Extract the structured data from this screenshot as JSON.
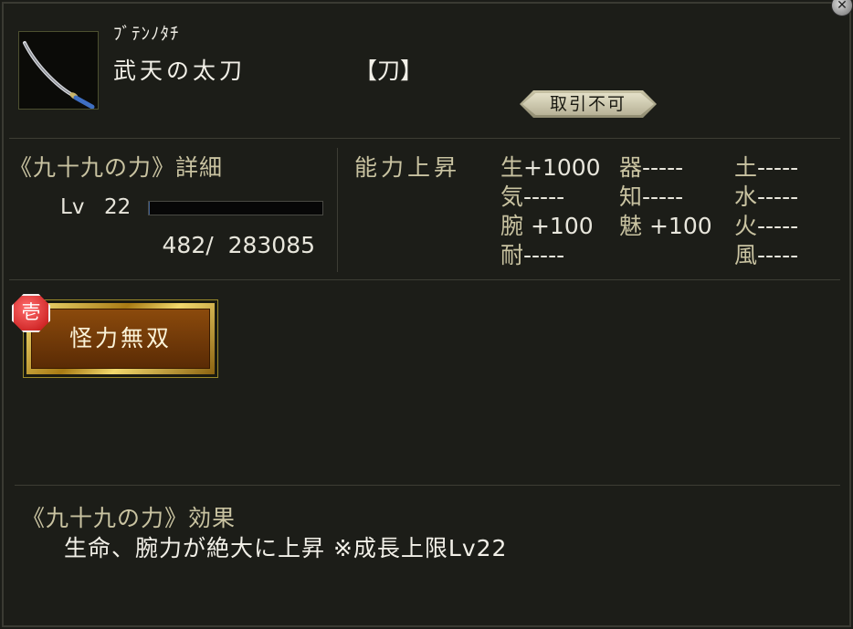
{
  "item": {
    "furigana": "ﾌﾞﾃﾝﾉﾀﾁ",
    "name": "武天の太刀",
    "type": "【刀】",
    "trade_status": "取引不可",
    "icon": "katana-icon"
  },
  "power_detail": {
    "title": "《九十九の力》詳細",
    "level_label": "Lv",
    "level_value": "22",
    "exp_text": "482/  283085",
    "exp_progress": 0.0017
  },
  "ability": {
    "title": "能力上昇",
    "stats": [
      {
        "label": "生",
        "value": "+1000"
      },
      {
        "label": "器",
        "value": "-----"
      },
      {
        "label": "土",
        "value": "-----"
      },
      {
        "label": "気",
        "value": "-----"
      },
      {
        "label": "知",
        "value": "-----"
      },
      {
        "label": "水",
        "value": "-----"
      },
      {
        "label": "腕",
        "value": " +100"
      },
      {
        "label": "魅",
        "value": " +100"
      },
      {
        "label": "火",
        "value": "-----"
      },
      {
        "label": "耐",
        "value": "-----"
      },
      {
        "label": "風",
        "value": "-----"
      }
    ]
  },
  "skill": {
    "rank": "壱",
    "name": "怪力無双"
  },
  "effect": {
    "title": "《九十九の力》効果",
    "text": "生命、腕力が絶大に上昇 ※成長上限Lv22"
  },
  "window": {
    "close_icon": "close-icon"
  }
}
